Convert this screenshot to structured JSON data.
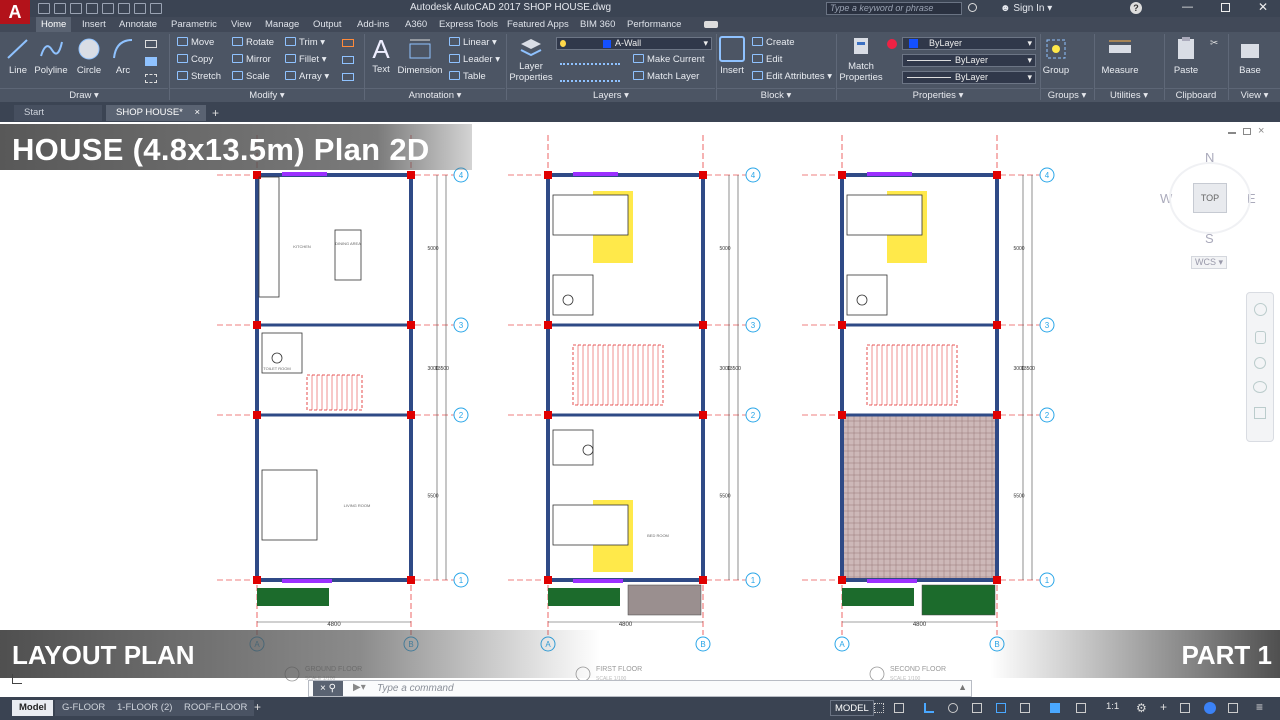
{
  "app": {
    "title": "Autodesk AutoCAD 2017   SHOP HOUSE.dwg",
    "search_placeholder": "Type a keyword or phrase",
    "sign_in": "Sign In"
  },
  "ribbon_tabs": [
    "Home",
    "Insert",
    "Annotate",
    "Parametric",
    "View",
    "Manage",
    "Output",
    "Add-ins",
    "A360",
    "Express Tools",
    "Featured Apps",
    "BIM 360",
    "Performance"
  ],
  "draw": {
    "line": "Line",
    "polyline": "Polyline",
    "circle": "Circle",
    "arc": "Arc",
    "label": "Draw"
  },
  "modify": {
    "move": "Move",
    "rotate": "Rotate",
    "trim": "Trim",
    "copy": "Copy",
    "mirror": "Mirror",
    "fillet": "Fillet",
    "stretch": "Stretch",
    "scale": "Scale",
    "array": "Array",
    "label": "Modify"
  },
  "annotation": {
    "text": "Text",
    "dimension": "Dimension",
    "linear": "Linear",
    "leader": "Leader",
    "table": "Table",
    "label": "Annotation"
  },
  "layers": {
    "layer_properties": "Layer Properties",
    "current_layer": "A-Wall",
    "make_current": "Make Current",
    "match_layer": "Match Layer",
    "label": "Layers"
  },
  "block": {
    "insert": "Insert",
    "create": "Create",
    "edit": "Edit",
    "edit_attributes": "Edit Attributes",
    "label": "Block"
  },
  "properties": {
    "match_properties": "Match Properties",
    "color": "ByLayer",
    "linetype": "ByLayer",
    "lineweight": "ByLayer",
    "label": "Properties"
  },
  "groups": {
    "group": "Group",
    "label": "Groups"
  },
  "utilities": {
    "measure": "Measure",
    "label": "Utilities"
  },
  "clipboard": {
    "paste": "Paste",
    "label": "Clipboard"
  },
  "view_panel": {
    "base": "Base",
    "label": "View"
  },
  "doc_tabs": [
    "Start",
    "SHOP HOUSE*"
  ],
  "overlay": {
    "title": "HOUSE (4.8x13.5m) Plan 2D",
    "bottom_left": "LAYOUT PLAN",
    "bottom_right": "PART 1"
  },
  "viewcube": {
    "n": "N",
    "s": "S",
    "e": "E",
    "w": "W",
    "top": "TOP",
    "wcs": "WCS"
  },
  "plans": [
    {
      "name": "GROUND FLOOR",
      "scale": "SCALE 1/100"
    },
    {
      "name": "FIRST FLOOR",
      "scale": "SCALE 1/100"
    },
    {
      "name": "SECOND FLOOR",
      "scale": "SCALE 1/100"
    }
  ],
  "room_labels": {
    "kitchen": "KITCHEN",
    "dining": "DINING AREA",
    "toilet": "TOILET ROOM",
    "living": "LIVING ROOM",
    "bedroom": "BED ROOM"
  },
  "dims": {
    "width": "4800",
    "d1": "5000",
    "d2": "3000",
    "d3": "5500",
    "total": "13500"
  },
  "grid": {
    "cols": [
      "A",
      "B"
    ],
    "rows": [
      "1",
      "2",
      "3",
      "4"
    ]
  },
  "command": {
    "placeholder": "Type a command"
  },
  "layout_tabs": [
    "Model",
    "G-FLOOR",
    "1-FLOOR (2)",
    "ROOF-FLOOR"
  ],
  "status": {
    "model": "MODEL",
    "scale": "1:1"
  },
  "colors": {
    "wall": "#2f4a86",
    "column": "#e00000",
    "grid": "#2aa6e8",
    "stair": "#e02020",
    "window": "#9b30ff",
    "planter": "#1c6b2c",
    "yellow": "#ffe94a"
  }
}
